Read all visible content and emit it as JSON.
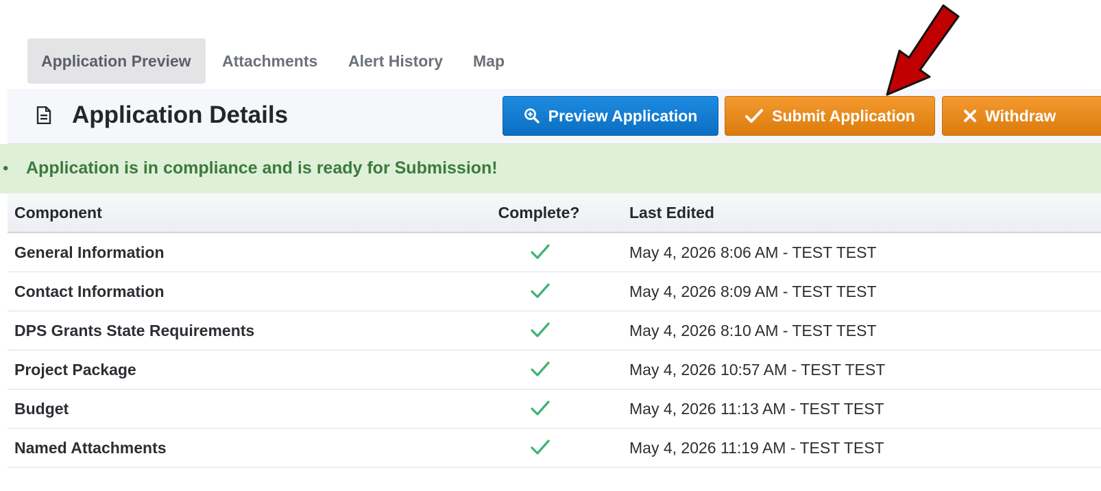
{
  "tabs": [
    {
      "label": "Application Preview",
      "active": true
    },
    {
      "label": "Attachments",
      "active": false
    },
    {
      "label": "Alert History",
      "active": false
    },
    {
      "label": "Map",
      "active": false
    }
  ],
  "header": {
    "title": "Application Details",
    "title_icon": "document-icon",
    "buttons": {
      "preview": {
        "label": "Preview Application",
        "icon": "zoom-in-icon",
        "color": "#0b73c8"
      },
      "submit": {
        "label": "Submit Application",
        "icon": "checkmark-icon",
        "color": "#e8860f"
      },
      "withdraw": {
        "label": "Withdraw",
        "icon": "x-icon",
        "color": "#e8860f"
      }
    }
  },
  "alert": {
    "message": "Application is in compliance and is ready for Submission!",
    "color": "#3c7a3c",
    "background": "#dff0d8"
  },
  "table": {
    "columns": [
      "Component",
      "Complete?",
      "Last Edited"
    ],
    "rows": [
      {
        "component": "General Information",
        "complete": true,
        "last_edited": "May 4, 2026 8:06 AM - TEST TEST"
      },
      {
        "component": "Contact Information",
        "complete": true,
        "last_edited": "May 4, 2026 8:09 AM - TEST TEST"
      },
      {
        "component": "DPS Grants State Requirements",
        "complete": true,
        "last_edited": "May 4, 2026 8:10 AM - TEST TEST"
      },
      {
        "component": "Project Package",
        "complete": true,
        "last_edited": "May 4, 2026 10:57 AM - TEST TEST"
      },
      {
        "component": "Budget",
        "complete": true,
        "last_edited": "May 4, 2026 11:13 AM - TEST TEST"
      },
      {
        "component": "Named Attachments",
        "complete": true,
        "last_edited": "May 4, 2026 11:19 AM - TEST TEST"
      }
    ],
    "check_color": "#3cb371"
  },
  "annotation": {
    "icon": "red-arrow-icon",
    "color": "#c00000"
  }
}
